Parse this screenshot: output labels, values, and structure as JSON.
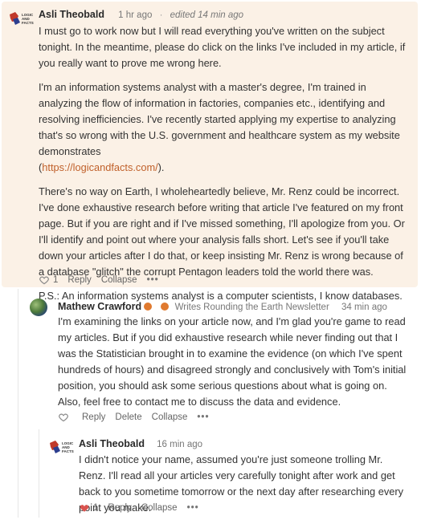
{
  "comments": [
    {
      "author": "Asli Theobald",
      "time": "1 hr ago",
      "edited": "edited 14 min ago",
      "paragraphs": [
        "I must go to work now but I will read everything you've written on the subject tonight. In the meantime, please do click on the links I've included in my article, if you really want to prove me wrong here.",
        "I'm an information systems analyst with a master's degree, I'm trained in analyzing the flow of information in factories, companies etc., identifying and resolving inefficiencies. I've recently started applying my expertise to analyzing that's so wrong with the U.S. government and healthcare system as my website demonstrates",
        "There's no way on Earth, I wholeheartedly believe, Mr. Renz could be incorrect. I've done exhaustive research before writing that article I've featured on my front page. But if you are right and if I've missed something, I'll apologize from you. Or I'll identify and point out where your analysis falls short. Let's see if you'll take down your articles after I do that, or keep insisting Mr. Renz is wrong because of a database \"glitch\" the corrupt Pentagon leaders told the world there was.",
        "P.S.: An information systems analyst is a computer scientists, I know databases."
      ],
      "link_prefix": "(",
      "link_text": "https://logicandfacts.com/",
      "link_suffix": ").",
      "likes": "1",
      "reply": "Reply",
      "collapse": "Collapse",
      "more": "•••"
    },
    {
      "author": "Mathew Crawford",
      "newsletter": "Writes Rounding the Earth Newsletter",
      "time": "34 min ago",
      "paragraphs": [
        "I'm examining the links on your article now, and I'm glad you're game to read my articles. But if you did exhaustive research while never finding out that I was the Statistician brought in to examine the evidence (on which I've spent hundreds of hours) and disagreed strongly and conclusively with Tom's initial position, you should ask some serious questions about what is going on. Also, feel free to contact me to discuss the data and evidence."
      ],
      "reply": "Reply",
      "delete": "Delete",
      "collapse": "Collapse",
      "more": "•••"
    },
    {
      "author": "Asli Theobald",
      "time": "16 min ago",
      "paragraphs": [
        "I didn't notice your name, assumed you're just someone trolling Mr. Renz. I'll read all your articles very carefully tonight after work and get back to you sometime tomorrow or the next day after researching every point you make."
      ],
      "likes": "1",
      "reply": "Reply",
      "collapse": "Collapse",
      "more": "•••"
    }
  ],
  "colors": {
    "highlight_bg": "#fbf1e6",
    "link": "#c0602a",
    "liked_heart": "#d9534f",
    "newsletter_badge": "#e07a2f"
  }
}
